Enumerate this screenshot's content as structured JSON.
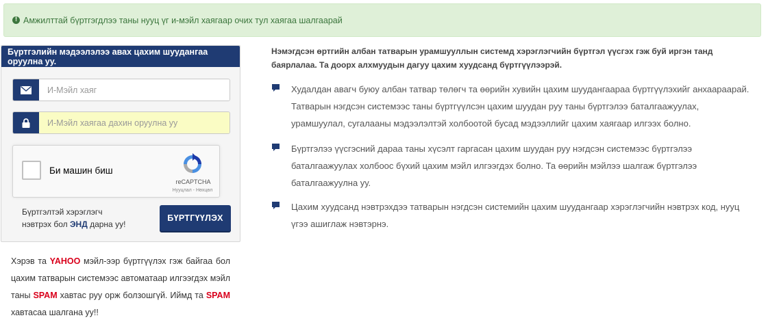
{
  "alert": {
    "message": "Амжилттай бүртгэгдлээ таны нууц үг и-мэйл хаягаар очих тул хаягаа шалгаарай",
    "icon": "exclamation-circle-icon"
  },
  "panel": {
    "heading": "Бүртгэлийн мэдээлэлээ авах цахим шуудангаа оруулна уу.",
    "email": {
      "placeholder": "И-Мэйл хаяг",
      "icon": "envelope-icon"
    },
    "email_confirm": {
      "placeholder": "И-Мэйл хаягаа дахин оруулна уу",
      "icon": "lock-icon"
    },
    "captcha": {
      "label": "Би машин биш",
      "brand": "reCAPTCHA",
      "terms": "Нууцлал - Нөхцөл"
    },
    "login_prefix": "Бүртгэлтэй хэрэглэгч",
    "login_mid": "нэвтрэх бол ",
    "login_link": "ЭНД",
    "login_suffix": " дарна уу!",
    "register_label": "БҮРТГҮҮЛЭХ"
  },
  "yahoo_note": {
    "p1": "Хэрэв та ",
    "yahoo": "YAHOO",
    "p2": " мэйл-ээр бүртгүүлэх гэж байгаа бол цахим татварын системээс автоматаар илгээгдэх мэйл таны ",
    "spam1": "SPAM",
    "p3": " хавтас руу орж болзошгүй. Иймд та ",
    "spam2": "SPAM",
    "p4": " хавтасаа шалгана уу!!"
  },
  "intro": "Нэмэгдсэн өртгийн албан татварын урамшууллын системд хэрэглэгчийн бүртгэл үүсгэх гэж буй иргэн танд баярлалаа. Та доорх алхмуудын дагуу цахим хуудсанд бүртгүүлээрэй.",
  "bullets": [
    {
      "text": "Худалдан авагч буюу албан татвар төлөгч та өөрийн хувийн цахим шуудангаараа бүртгүүлэхийг анхаараарай. Татварын нэгдсэн системээс таны бүртгүүлсэн цахим шуудан руу таны бүртгэлээ баталгаажуулах, урамшуулал, сугалааны мэдээлэлтэй холбоотой бусад мэдээллийг цахим хаягаар илгээх болно."
    },
    {
      "text": "Бүртгэлээ үүсгэсний дараа таны хүсэлт гаргасан цахим шуудан руу нэгдсэн системээс бүртгэлээ баталгаажуулах холбоос бүхий цахим мэйл илгээгдэх болно. Та өөрийн мэйлээ шалгаж бүртгэлээ баталгаажуулна уу."
    },
    {
      "text": "Цахим хуудсанд нэвтрэхдээ татварын нэгдсэн системийн цахим шуудангаар хэрэглэгчийн нэвтрэх код, нууц үгээ ашиглаж нэвтэрнэ."
    }
  ],
  "colors": {
    "primary": "#1f3b73",
    "alert_bg": "#dff0d8",
    "alert_text": "#3c763d",
    "warn_red": "#d9001b"
  }
}
